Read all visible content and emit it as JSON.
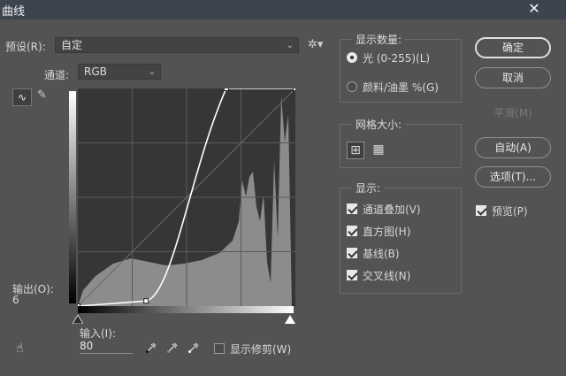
{
  "window": {
    "title": "曲线",
    "close_glyph": "✕"
  },
  "preset": {
    "label": "预设(R):",
    "value": "自定"
  },
  "channel": {
    "label": "通道:",
    "value": "RGB"
  },
  "output": {
    "label": "输出(O):",
    "value": "6"
  },
  "input": {
    "label": "输入(I):",
    "value": "80"
  },
  "show_clipping": {
    "label": "显示修剪(W)",
    "checked": false
  },
  "display_amount": {
    "title": "显示数量:",
    "options": [
      {
        "label": "光 (0-255)(L)",
        "selected": true
      },
      {
        "label": "颜料/油墨 %(G)",
        "selected": false
      }
    ]
  },
  "grid_size": {
    "title": "网格大小:"
  },
  "display": {
    "title": "显示:",
    "options": [
      {
        "label": "通道叠加(V)",
        "checked": true
      },
      {
        "label": "直方图(H)",
        "checked": true
      },
      {
        "label": "基线(B)",
        "checked": true
      },
      {
        "label": "交叉线(N)",
        "checked": true
      }
    ]
  },
  "buttons": {
    "ok": "确定",
    "cancel": "取消",
    "smooth": "平滑(M)",
    "auto": "自动(A)",
    "options": "选项(T)..."
  },
  "preview": {
    "label": "预览(P)",
    "checked": true
  },
  "icons": {
    "gear": "gear-icon",
    "curve_tool": "curve-point-icon",
    "pencil": "pencil-icon",
    "black_eyedropper": "eyedropper-black-icon",
    "gray_eyedropper": "eyedropper-gray-icon",
    "white_eyedropper": "eyedropper-white-icon",
    "target_adjust": "target-adjust-hand-icon",
    "grid_coarse": "grid-4-icon",
    "grid_fine": "grid-10-icon"
  },
  "colors": {
    "panel": "#535353",
    "titlebar": "#3c4450",
    "graph_bg": "#353535",
    "histogram": "#8a8a8a",
    "curve": "#ffffff"
  },
  "curve_points": [
    [
      0,
      0
    ],
    [
      80,
      6
    ],
    [
      174,
      255
    ],
    [
      255,
      255
    ]
  ]
}
